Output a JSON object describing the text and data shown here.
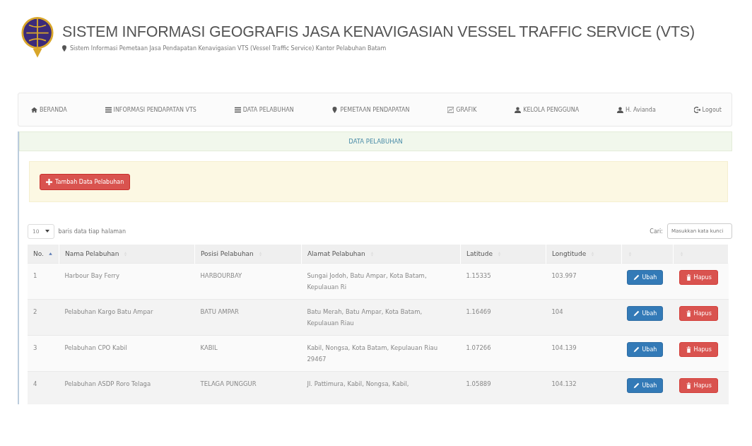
{
  "header": {
    "title": "SISTEM INFORMASI GEOGRAFIS JASA KENAVIGASIAN VESSEL TRAFFIC SERVICE (VTS)",
    "subtitle": "Sistem Informasi Pemetaan Jasa Pendapatan Kenavigasian VTS (Vessel Traffic Service) Kantor Pelabuhan Batam"
  },
  "nav": [
    {
      "label": "BERANDA"
    },
    {
      "label": "INFORMASI PENDAPATAN VTS"
    },
    {
      "label": "DATA PELABUHAN"
    },
    {
      "label": "PEMETAAN PENDAPATAN"
    },
    {
      "label": "GRAFIK"
    },
    {
      "label": "KELOLA PENGGUNA"
    },
    {
      "label": "H. Avianda"
    },
    {
      "label": "Logout"
    }
  ],
  "section_title": "DATA PELABUHAN",
  "add_button": "Tambah Data Pelabuhan",
  "page_length": {
    "value": "10",
    "label": "baris data tiap halaman"
  },
  "search": {
    "label": "Cari:",
    "placeholder": "Masukkan kata kunci"
  },
  "table": {
    "columns": [
      {
        "label": "No.",
        "sorted": true
      },
      {
        "label": "Nama Pelabuhan",
        "sorted": false
      },
      {
        "label": "Posisi Pelabuhan",
        "sorted": false
      },
      {
        "label": "Alamat Pelabuhan",
        "sorted": false
      },
      {
        "label": "Latitude",
        "sorted": false
      },
      {
        "label": "Longtitude",
        "sorted": false
      },
      {
        "sorted": false
      },
      {
        "sorted": false
      }
    ],
    "rows": [
      {
        "cells": [
          "1",
          "Harbour Bay Ferry",
          "HARBOURBAY",
          "Sungai Jodoh, Batu Ampar, Kota Batam, Kepulauan Ri",
          "1.15335",
          "103.997"
        ],
        "edit": "Ubah",
        "delete": "Hapus"
      },
      {
        "cells": [
          "2",
          "Pelabuhan Kargo Batu Ampar",
          "BATU AMPAR",
          "Batu Merah, Batu Ampar, Kota Batam, Kepulauan Riau",
          "1.16469",
          "104"
        ],
        "edit": "Ubah",
        "delete": "Hapus"
      },
      {
        "cells": [
          "3",
          "Pelabuhan CPO Kabil",
          "KABIL",
          "Kabil, Nongsa, Kota Batam, Kepulauan Riau 29467",
          "1.07266",
          "104.139"
        ],
        "edit": "Ubah",
        "delete": "Hapus"
      },
      {
        "cells": [
          "4",
          "Pelabuhan ASDP Roro Telaga",
          "TELAGA PUNGGUR",
          "Jl. Pattimura, Kabil, Nongsa, Kabil,",
          "1.05889",
          "104.132"
        ],
        "edit": "Ubah",
        "delete": "Hapus"
      }
    ]
  }
}
